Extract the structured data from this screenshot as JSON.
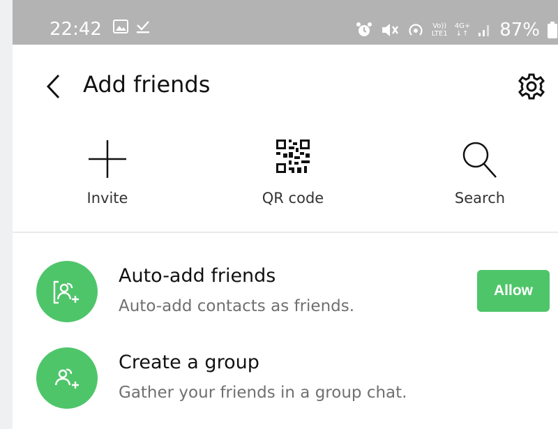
{
  "status_bar": {
    "time": "22:42",
    "battery": "87%",
    "volte_label": "Vo))",
    "lte_label": "LTE1",
    "net_label": "4G+",
    "icons": [
      "image-icon",
      "download-check-icon",
      "alarm-icon",
      "mute-icon",
      "hotspot-icon",
      "volte-icon",
      "4g-icon",
      "signal-icon",
      "battery-icon"
    ]
  },
  "header": {
    "title": "Add friends",
    "back_icon": "chevron-left-icon",
    "settings_icon": "gear-icon"
  },
  "actions": [
    {
      "label": "Invite",
      "icon": "plus-icon"
    },
    {
      "label": "QR code",
      "icon": "qr-code-icon"
    },
    {
      "label": "Search",
      "icon": "search-icon"
    }
  ],
  "list": [
    {
      "title": "Auto-add friends",
      "subtitle": "Auto-add contacts as friends.",
      "icon": "auto-add-friends-icon",
      "button": "Allow"
    },
    {
      "title": "Create a group",
      "subtitle": "Gather your friends in a group chat.",
      "icon": "create-group-icon"
    }
  ],
  "colors": {
    "accent": "#4fc56a",
    "status_bar": "#b3b3b3"
  }
}
